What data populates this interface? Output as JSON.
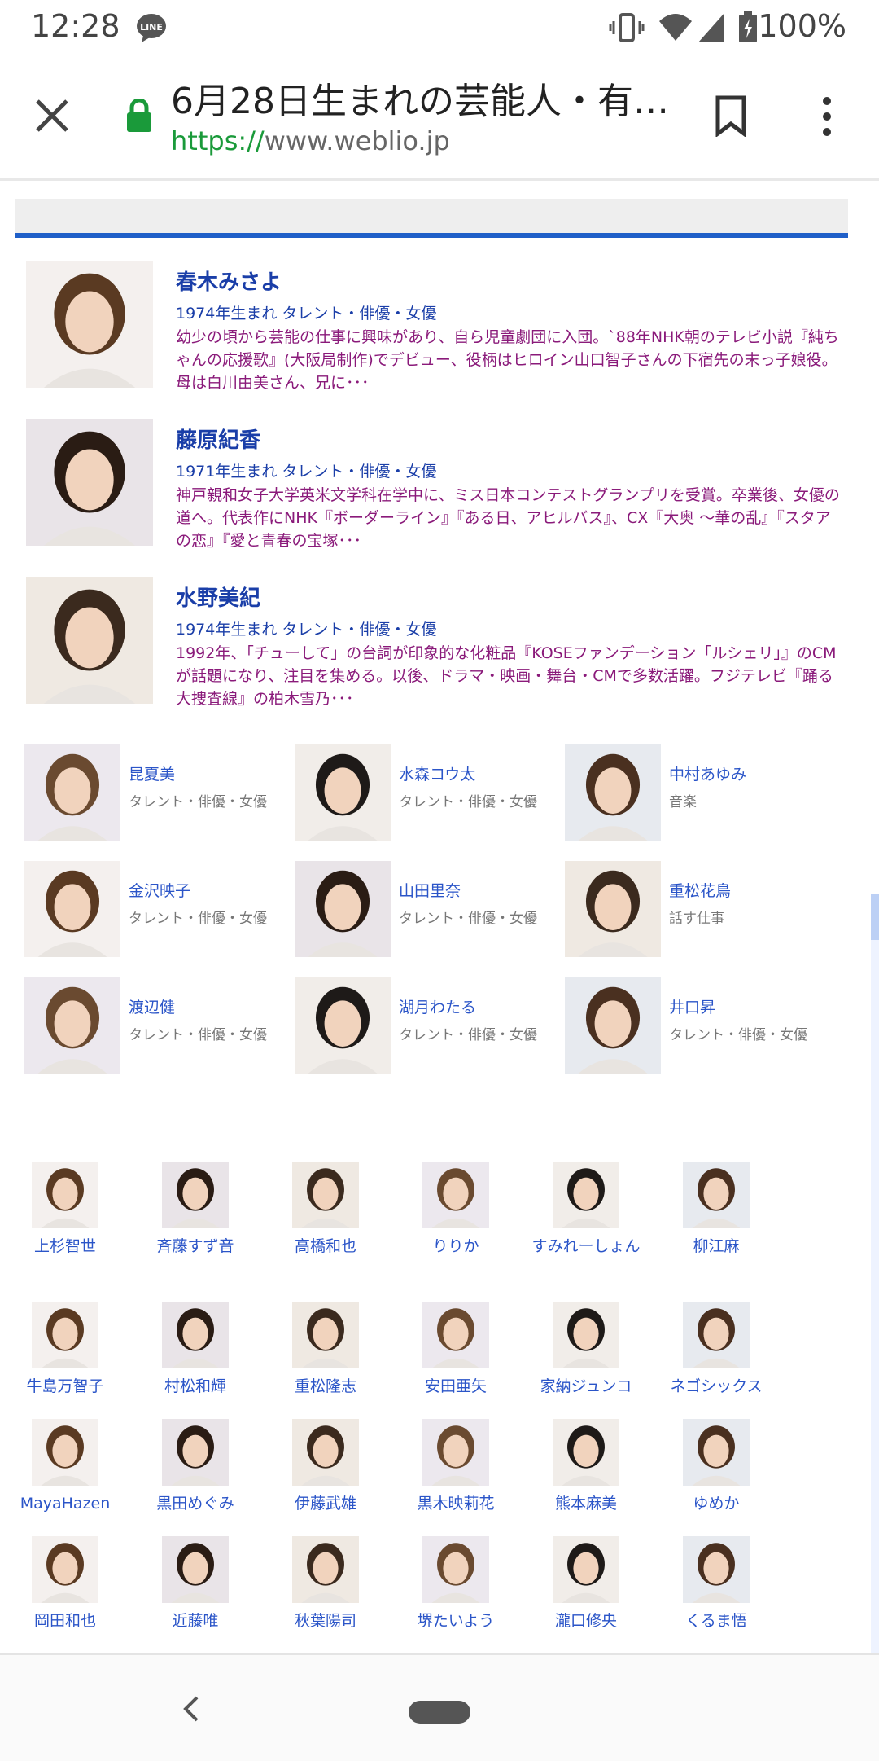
{
  "status_bar": {
    "time": "12:28",
    "notification_icon": "line-app-icon",
    "icons": [
      "vibrate-icon",
      "wifi-icon",
      "signal-icon",
      "battery-charging-icon"
    ],
    "battery": "100%"
  },
  "toolbar": {
    "title": "6月28日生まれの芸能人・有…",
    "url_protocol": "https://",
    "url_host": "www.weblio.jp",
    "close_icon": "close-icon",
    "lock_icon": "lock-icon",
    "bookmark_icon": "bookmark-icon",
    "menu_icon": "more-vert-icon"
  },
  "featured": [
    {
      "name": "春木みさよ",
      "meta": "1974年生まれ タレント・俳優・女優",
      "desc": "幼少の頃から芸能の仕事に興味があり、自ら児童劇団に入団。`88年NHK朝のテレビ小説『純ちゃんの応援歌』(大阪局制作)でデビュー、役柄はヒロイン山口智子さんの下宿先の末っ子娘役。母は白川由美さん、兄に･･･"
    },
    {
      "name": "藤原紀香",
      "meta": "1971年生まれ タレント・俳優・女優",
      "desc": "神戸親和女子大学英米文学科在学中に、ミス日本コンテストグランプリを受賞。卒業後、女優の道へ。代表作にNHK『ボーダーライン』『ある日、アヒルバス』、CX『大奥 〜華の乱』『スタアの恋』『愛と青春の宝塚･･･"
    },
    {
      "name": "水野美紀",
      "meta": "1974年生まれ タレント・俳優・女優",
      "desc": "1992年、「チューして」の台詞が印象的な化粧品『KOSEファンデーション「ルシェリ」』のCMが話題になり、注目を集める。以後、ドラマ・映画・舞台・CMで多数活躍。フジテレビ『踊る大捜査線』の柏木雪乃･･･"
    }
  ],
  "grid3": [
    {
      "name": "昆夏美",
      "cat": "タレント・俳優・女優"
    },
    {
      "name": "水森コウ太",
      "cat": "タレント・俳優・女優"
    },
    {
      "name": "中村あゆみ",
      "cat": "音楽"
    },
    {
      "name": "金沢映子",
      "cat": "タレント・俳優・女優"
    },
    {
      "name": "山田里奈",
      "cat": "タレント・俳優・女優"
    },
    {
      "name": "重松花鳥",
      "cat": "話す仕事"
    },
    {
      "name": "渡辺健",
      "cat": "タレント・俳優・女優"
    },
    {
      "name": "湖月わたる",
      "cat": "タレント・俳優・女優"
    },
    {
      "name": "井口昇",
      "cat": "タレント・俳優・女優"
    }
  ],
  "grid6": [
    "上杉智世",
    "斉藤すず音",
    "高橋和也",
    "りりか",
    "すみれーしょん",
    "柳江麻",
    "牛島万智子",
    "村松和輝",
    "重松隆志",
    "安田亜矢",
    "家納ジュンコ",
    "ネゴシックス",
    "MayaHazen",
    "黒田めぐみ",
    "伊藤武雄",
    "黒木映莉花",
    "熊本麻美",
    "ゆめか",
    "岡田和也",
    "近藤唯",
    "秋葉陽司",
    "堺たいよう",
    "瀧口修央",
    "くるま悟"
  ],
  "nav": {
    "back_icon": "back-chevron-icon",
    "home_icon": "home-pill-icon"
  }
}
